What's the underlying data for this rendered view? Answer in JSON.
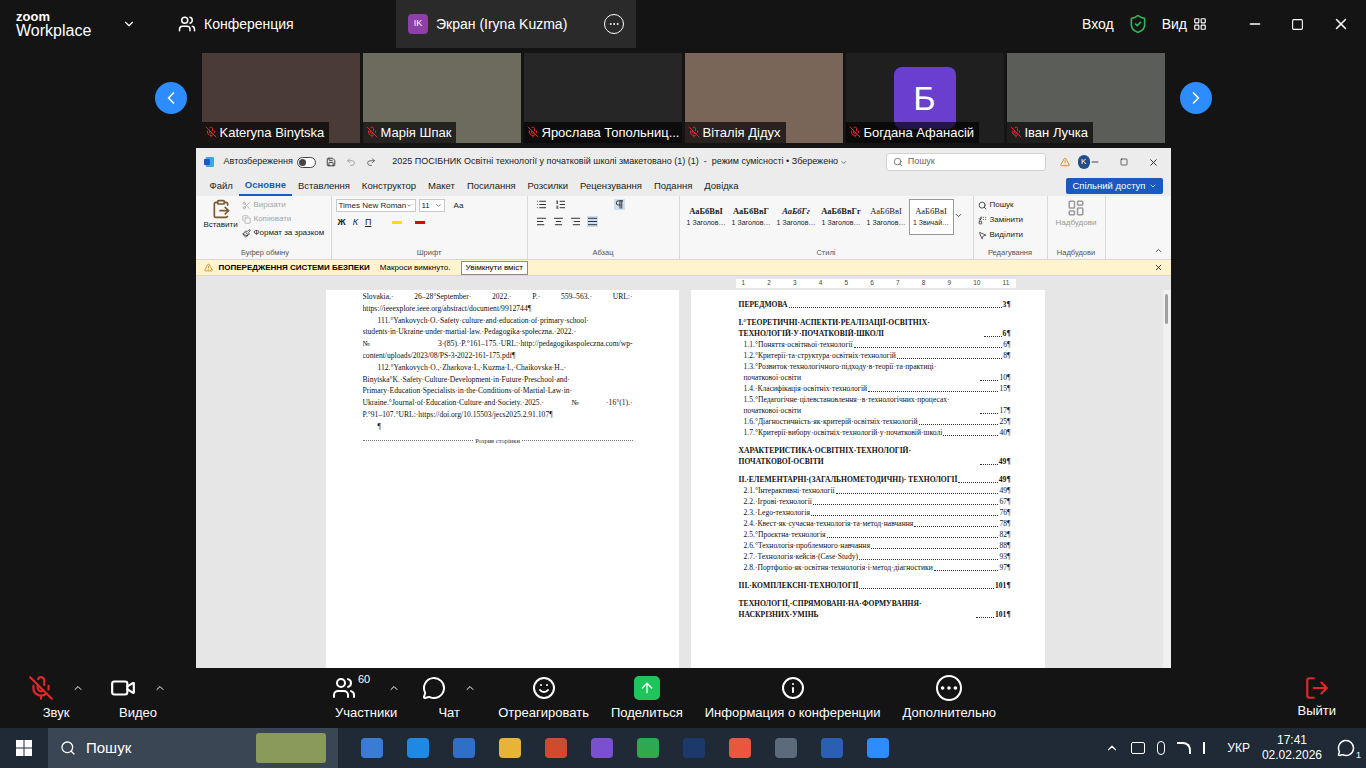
{
  "zoom": {
    "brand": "zoom",
    "product": "Workplace",
    "tabs": [
      {
        "label": "Конференция",
        "avatar": "",
        "selected": false
      },
      {
        "label": "Экран (Iryna Kuzma)",
        "avatar": "IK",
        "selected": true
      }
    ],
    "sign_in": "Вход",
    "view": "Вид"
  },
  "participants": [
    {
      "name": "Kateryna Binytska",
      "muted": true,
      "kind": "video",
      "letter": "",
      "color": "#4b3b36"
    },
    {
      "name": "Марія Шпак",
      "muted": true,
      "kind": "video",
      "letter": "",
      "color": "#6d6a5e"
    },
    {
      "name": "Ярослава Топольниц...",
      "muted": true,
      "kind": "video",
      "letter": "",
      "color": "#262626"
    },
    {
      "name": "Віталія Дідух",
      "muted": true,
      "kind": "video",
      "letter": "",
      "color": "#7a6559"
    },
    {
      "name": "Богдана Афанасій",
      "muted": true,
      "kind": "avatar",
      "letter": "Б",
      "color": "#6a3fd0"
    },
    {
      "name": "Іван Лучка",
      "muted": true,
      "kind": "video",
      "letter": "",
      "color": "#5b5d58"
    }
  ],
  "word": {
    "autosave_label": "Автозбереження",
    "autosave_on": false,
    "title": "2025 ПОСІБНИК Освітні технології у початковій школі змакетовано (1) (1)  -  режим сумісності • Збережено",
    "search": "Пошук",
    "user": "K",
    "tabs": [
      {
        "label": "Файл",
        "selected": false
      },
      {
        "label": "Основне",
        "selected": true
      },
      {
        "label": "Вставлення",
        "selected": false
      },
      {
        "label": "Конструктор",
        "selected": false
      },
      {
        "label": "Макет",
        "selected": false
      },
      {
        "label": "Посилання",
        "selected": false
      },
      {
        "label": "Розсилки",
        "selected": false
      },
      {
        "label": "Рецензування",
        "selected": false
      },
      {
        "label": "Подання",
        "selected": false
      },
      {
        "label": "Довідка",
        "selected": false
      }
    ],
    "share": "Спільний доступ",
    "clipboard": {
      "paste": "Вставити",
      "items": [
        {
          "label": "Вирізати",
          "disabled": true
        },
        {
          "label": "Копіювати",
          "disabled": true
        },
        {
          "label": "Формат за зразком",
          "disabled": false
        }
      ],
      "label": "Буфер обміну"
    },
    "font": {
      "name": "Times New Roman",
      "size": "11",
      "buttons": [
        "Ж",
        "К",
        "П"
      ],
      "case": "Аа",
      "label": "Шрифт"
    },
    "paragraph": {
      "label": "Абзац"
    },
    "styles": {
      "items": [
        {
          "sample": "АаБбВвІ",
          "name": "1 Заголов…",
          "selected": false,
          "kind": "bold"
        },
        {
          "sample": "АаБбВвГ",
          "name": "1 Заголов…",
          "selected": false,
          "kind": "bold"
        },
        {
          "sample": "АаБбГг",
          "name": "1 Заголов…",
          "selected": false,
          "kind": "italic"
        },
        {
          "sample": "АаБбВвГг",
          "name": "1 Заголов…",
          "selected": false,
          "kind": "bold"
        },
        {
          "sample": "АаБбВвІ",
          "name": "1 Заголов…",
          "selected": false,
          "kind": "plain"
        },
        {
          "sample": "АаБбВвІ",
          "name": "1 Звичай…",
          "selected": true,
          "kind": "plain"
        }
      ],
      "label": "Стилі"
    },
    "editing": {
      "items": [
        "Пошук",
        "Замінити",
        "Виділити"
      ],
      "label": "Редагування"
    },
    "addins": {
      "item": "Надбудови",
      "label": "Надбудови"
    },
    "security": {
      "title": "ПОПЕРЕДЖЕННЯ СИСТЕМИ БЕЗПЕКИ",
      "message": "Макроси вимкнуто.",
      "button": "Увімкнути вміст"
    },
    "ruler": [
      "1",
      "2",
      "3",
      "4",
      "5",
      "6",
      "7",
      "8",
      "9",
      "10",
      "11"
    ],
    "left_page": {
      "lines": [
        {
          "text": "Slovakia,· 26–28°September· 2022.· P.· 559–563.· URL:·",
          "kind": "middle"
        },
        {
          "text": "https://ieeexplore.ieee.org/abstract/document/9912744¶",
          "kind": "end"
        },
        {
          "text": "111.°Yankovych·O.·Safety·culture·and·education·of·primary·school·",
          "kind": "start"
        },
        {
          "text": "students·in·Ukraine·under·martial·law.·Pedagogika·społeczna.·2022.·",
          "kind": "middle"
        },
        {
          "text": "№3·(85).·P.°161–175.·URL:·http://pedagogikaspoleczna.com/wp-",
          "kind": "middle"
        },
        {
          "text": "content/uploads/2023/08/PS-3-2022-161-175.pdf¶",
          "kind": "end"
        },
        {
          "text": "112.°Yankovych·O.,·Zharkova·I.,·Kuzma·I.,·Chaikovska·H.,·",
          "kind": "start"
        },
        {
          "text": "Binytska°K.·Safety·Culture·Development·in·Future·Preschool·and·",
          "kind": "middle"
        },
        {
          "text": "Primary·Education·Specialists·in·the·Conditions·of·Martial·Law·in·",
          "kind": "middle"
        },
        {
          "text": "Ukraine.°Journal·of·Education·Culture·and·Society.·2025.·№·16°(1).·",
          "kind": "middle"
        },
        {
          "text": "P.°91–107.°URL:·https://doi.org/10.15503/jecs2025.2.91.107¶",
          "kind": "end"
        },
        {
          "text": "¶",
          "kind": "start"
        }
      ],
      "page_break": "Розрив сторінки"
    },
    "toc": [
      {
        "text": "ПЕРЕДМОВА",
        "page": "3¶",
        "bold": true,
        "sub": false
      },
      {
        "text": "І.°ТЕОРЕТИЧНІ·АСПЕКТИ·РЕАЛІЗАЦІЇ·ОСВІТНІХ· ТЕХНОЛОГІЙ·У·ПОЧАТКОВІЙ·ШКОЛІ",
        "page": "6¶",
        "bold": true,
        "sub": false
      },
      {
        "text": "1.1.°Поняття·освітньої·технології",
        "page": "6¶",
        "bold": false,
        "sub": true
      },
      {
        "text": "1.2.°Критерії·та·структура·освітніх·технологій",
        "page": "8¶",
        "bold": false,
        "sub": true
      },
      {
        "text": "1.3.°Розвиток·технологічного·підходу·в·теорії·та·практиці· початкової·освіти",
        "page": "10¶",
        "bold": false,
        "sub": true
      },
      {
        "text": "1.4.·Класифікація·освітніх·технологій",
        "page": "15¶",
        "bold": false,
        "sub": true
      },
      {
        "text": "1.5.°Педагогічне·цілевстановлення··в·технологічних·процесах· початкової·освіти",
        "page": "17¶",
        "bold": false,
        "sub": true
      },
      {
        "text": "1.6.°Діагностичність·як·критерій·освітніх·технологій",
        "page": "25¶",
        "bold": false,
        "sub": true
      },
      {
        "text": "1.7.°Критерії·вибору·освітніх·технологій·у·початковій·школі",
        "page": "40¶",
        "bold": false,
        "sub": true
      },
      {
        "text": "ХАРАКТЕРИСТИКА·ОСВІТНІХ·ТЕХНОЛОГІЙ· ПОЧАТКОВОЇ·ОСВІТИ",
        "page": "49¶",
        "bold": true,
        "sub": false
      },
      {
        "text": "ІІ.·ЕЛЕМЕНТАРНІ·(ЗАГАЛЬНОМЕТОДИЧНІ)· ТЕХНОЛОГІЇ",
        "page": "49¶",
        "bold": true,
        "sub": false
      },
      {
        "text": "2.1.°Інтерактивні·технології",
        "page": "49¶",
        "bold": false,
        "sub": true
      },
      {
        "text": "2.2.·Ігрові·технології",
        "page": "67¶",
        "bold": false,
        "sub": true
      },
      {
        "text": "2.3.·Lego-технологія",
        "page": "76¶",
        "bold": false,
        "sub": true
      },
      {
        "text": "2.4.·Квест·як·сучасна·технологія·та·метод·навчання",
        "page": "78¶",
        "bold": false,
        "sub": true
      },
      {
        "text": "2.5.°Проєктна·технологія",
        "page": "82¶",
        "bold": false,
        "sub": true
      },
      {
        "text": "2.6.°Технологія·проблемного·навчання",
        "page": "88¶",
        "bold": false,
        "sub": true
      },
      {
        "text": "2.7.·Технологія·кейсів·(Case·Study)",
        "page": "93¶",
        "bold": false,
        "sub": true
      },
      {
        "text": "2.8.·Портфоліо·як·освітня·технологія·і·метод·діагностики",
        "page": "97¶",
        "bold": false,
        "sub": true
      },
      {
        "text": "ІІІ.·КОМПЛЕКСНІ·ТЕХНОЛОГІЇ",
        "page": "101¶",
        "bold": true,
        "sub": false
      },
      {
        "text": "ТЕХНОЛОГІЇ,·СПРЯМОВАНІ·НА·ФОРМУВАННЯ· НАСКРІЗНИХ·УМІНЬ",
        "page": "101¶",
        "bold": true,
        "sub": false
      }
    ]
  },
  "toolbar": {
    "left": [
      {
        "label": "Звук",
        "badge": "",
        "menu": true,
        "muted": true
      },
      {
        "label": "Видео",
        "badge": "",
        "menu": true,
        "muted": false
      }
    ],
    "center": [
      {
        "label": "Участники",
        "badge": "60",
        "menu": true,
        "muted": false
      },
      {
        "label": "Чат",
        "badge": "",
        "menu": true,
        "muted": false
      },
      {
        "label": "Отреагировать",
        "badge": "",
        "menu": false,
        "muted": false
      },
      {
        "label": "Поделиться",
        "badge": "",
        "menu": false,
        "muted": false
      },
      {
        "label": "Информация о конференции",
        "badge": "",
        "menu": false,
        "muted": false
      },
      {
        "label": "Дополнительно",
        "badge": "",
        "menu": false,
        "muted": false
      }
    ],
    "leave": "Выйти"
  },
  "taskbar": {
    "search": "Пошук",
    "apps": [
      {
        "color": "#3a7bd5"
      },
      {
        "color": "#1e88e5"
      },
      {
        "color": "#2f6fc7"
      },
      {
        "color": "#e8b437"
      },
      {
        "color": "#d04a2f"
      },
      {
        "color": "#7a4fd0"
      },
      {
        "color": "#2fa84f"
      },
      {
        "color": "#1b3a6b"
      },
      {
        "color": "#e9573f"
      },
      {
        "color": "#5b6b7b"
      },
      {
        "color": "#2b5fb3"
      },
      {
        "color": "#2d8cff"
      }
    ],
    "lang": "УКР",
    "time": "17:41",
    "date": "02.02.2026",
    "notifications": "1"
  }
}
